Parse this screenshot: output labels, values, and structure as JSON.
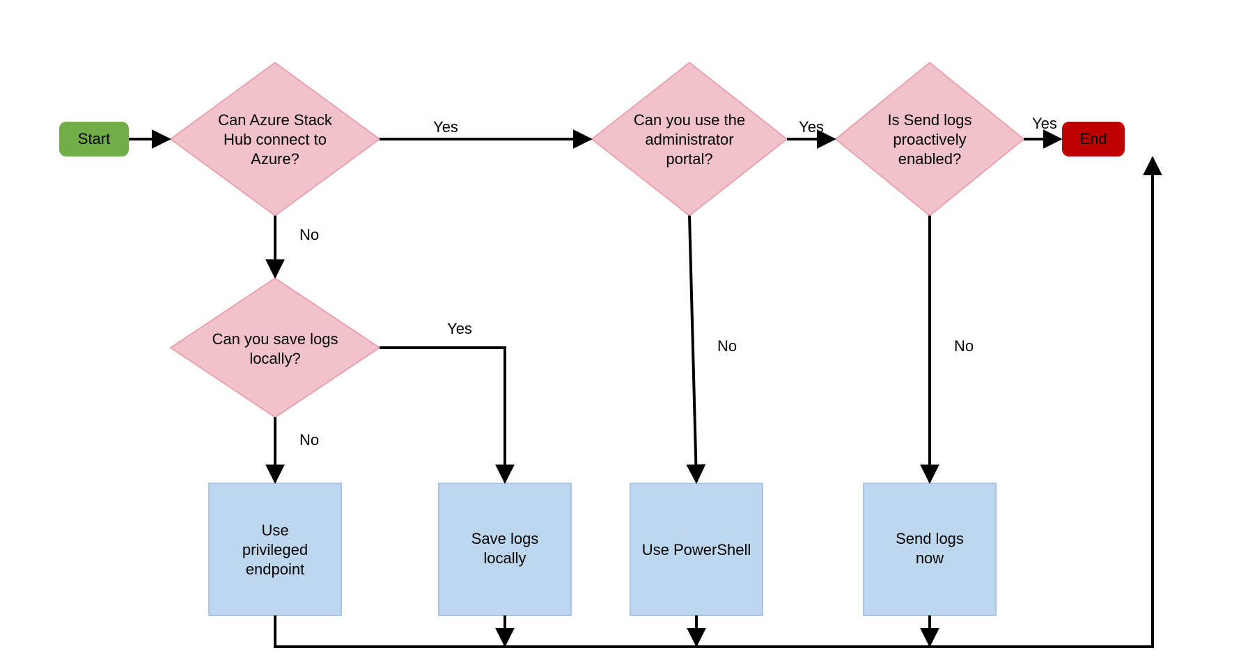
{
  "nodes": {
    "start": {
      "label": "Start"
    },
    "end": {
      "label": "End"
    },
    "d1": {
      "label_l1": "Can Azure Stack",
      "label_l2": "Hub connect to",
      "label_l3": "Azure?"
    },
    "d2": {
      "label_l1": "Can you save logs",
      "label_l2": "locally?"
    },
    "d3": {
      "label_l1": "Can you use the",
      "label_l2": "administrator",
      "label_l3": "portal?"
    },
    "d4": {
      "label_l1": "Is Send logs",
      "label_l2": "proactively",
      "label_l3": "enabled?"
    },
    "p1": {
      "label_l1": "Use",
      "label_l2": "privileged",
      "label_l3": "endpoint"
    },
    "p2": {
      "label_l1": "Save logs",
      "label_l2": "locally"
    },
    "p3": {
      "label_l1": "Use PowerShell"
    },
    "p4": {
      "label_l1": "Send logs",
      "label_l2": "now"
    }
  },
  "edges": {
    "d1_yes": "Yes",
    "d1_no": "No",
    "d2_yes": "Yes",
    "d2_no": "No",
    "d3_yes": "Yes",
    "d3_no": "No",
    "d4_yes": "Yes",
    "d4_no": "No"
  },
  "colors": {
    "start_fill": "#70ad47",
    "end_fill": "#c00000",
    "decision_fill": "#f1c2cb",
    "decision_stroke": "#e6a4b1",
    "process_fill": "#bdd7ee",
    "process_stroke": "#a9c5de",
    "line": "#000000"
  }
}
